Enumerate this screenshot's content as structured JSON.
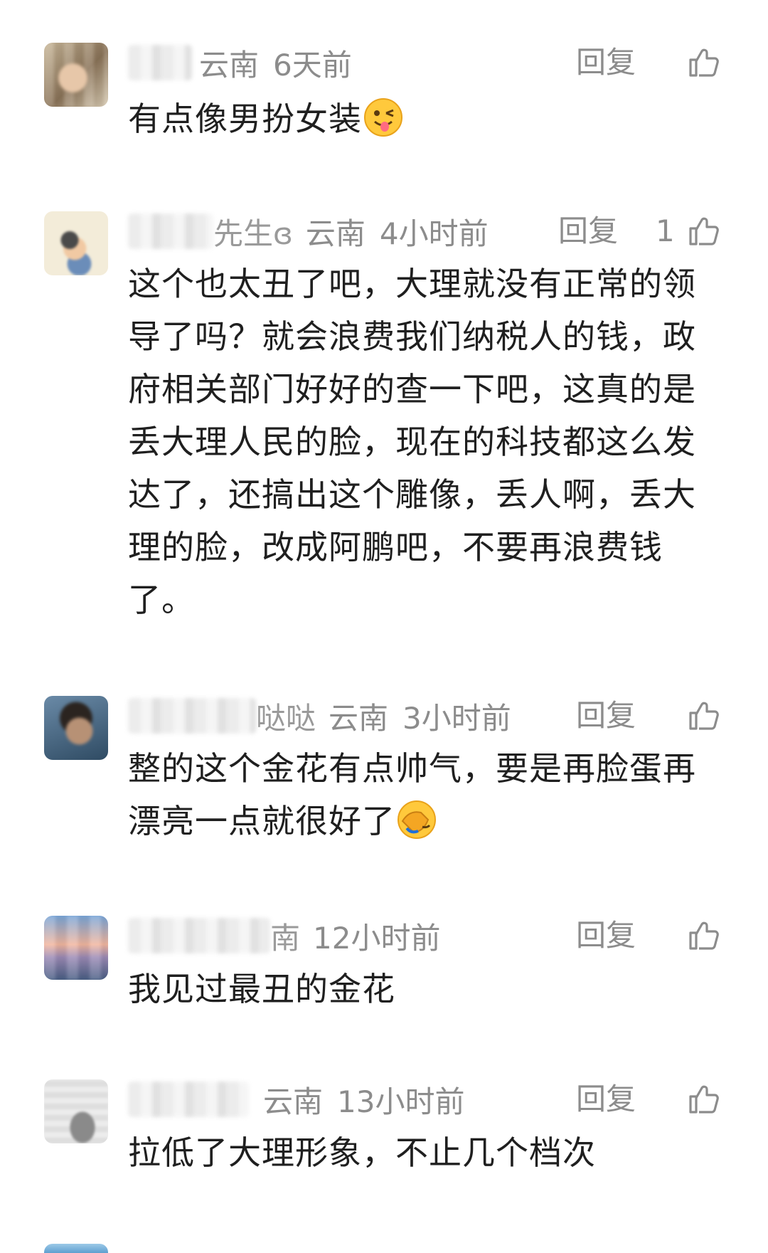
{
  "reply_label": "回复",
  "comments": [
    {
      "name_visible": "",
      "region": "云南",
      "time": "6天前",
      "likes": "",
      "content": "有点像男扮女装",
      "emoji": "winking-tongue-emoji"
    },
    {
      "name_visible": "先生ɞ",
      "region": "云南",
      "time": "4小时前",
      "likes": "1",
      "content": "这个也太丑了吧，大理就没有正常的领导了吗？就会浪费我们纳税人的钱，政府相关部门好好的查一下吧，这真的是丢大理人民的脸，现在的科技都这么发达了，还搞出这个雕像，丢人啊，丢大理的脸，改成阿鹏吧，不要再浪费钱了。"
    },
    {
      "name_visible": "哒哒",
      "region": "云南",
      "time": "3小时前",
      "likes": "",
      "content": "整的这个金花有点帅气，要是再脸蛋再漂亮一点就很好了",
      "emoji": "facepalm-emoji"
    },
    {
      "name_visible": "南",
      "region": "",
      "time": "12小时前",
      "likes": "",
      "content": "我见过最丑的金花"
    },
    {
      "name_visible": "",
      "region": "云南",
      "time": "13小时前",
      "likes": "",
      "content": "拉低了大理形象，不止几个档次"
    }
  ]
}
